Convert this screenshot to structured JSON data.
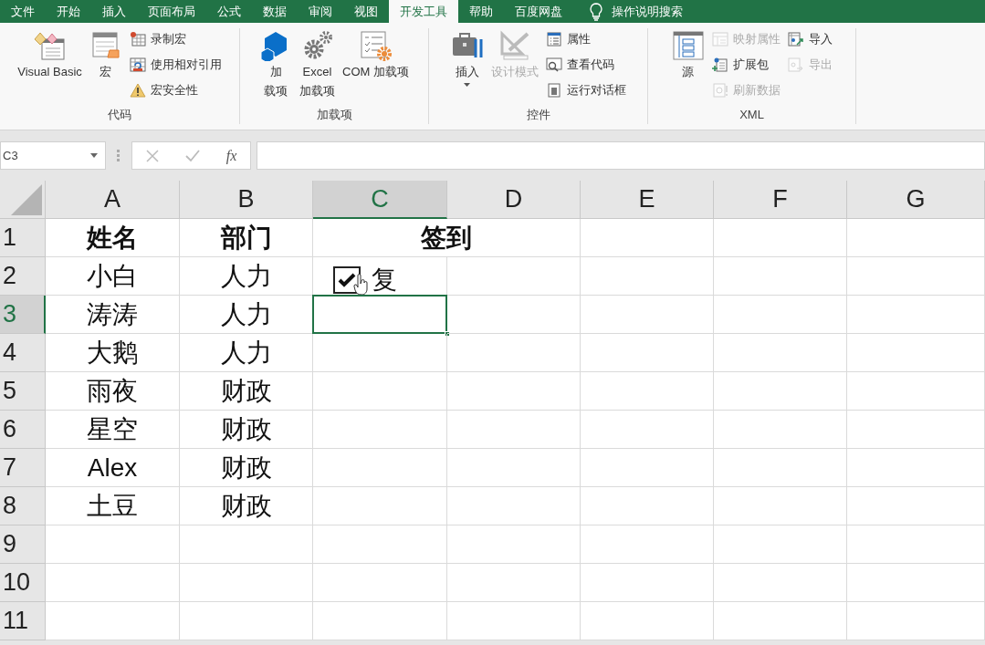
{
  "menu_tabs": [
    {
      "label": "文件",
      "selected": false
    },
    {
      "label": "开始",
      "selected": false
    },
    {
      "label": "插入",
      "selected": false
    },
    {
      "label": "页面布局",
      "selected": false
    },
    {
      "label": "公式",
      "selected": false
    },
    {
      "label": "数据",
      "selected": false
    },
    {
      "label": "审阅",
      "selected": false
    },
    {
      "label": "视图",
      "selected": false
    },
    {
      "label": "开发工具",
      "selected": true
    },
    {
      "label": "帮助",
      "selected": false
    },
    {
      "label": "百度网盘",
      "selected": false
    }
  ],
  "tell_me": {
    "placeholder": "操作说明搜索"
  },
  "ribbon_groups": [
    {
      "title": "代码",
      "columns": [
        [
          {
            "label": "Visual Basic",
            "kind": "large",
            "disabled": false
          }
        ],
        [
          {
            "label": "宏",
            "kind": "large",
            "disabled": false
          }
        ],
        [
          {
            "label": "录制宏",
            "kind": "small",
            "disabled": false
          },
          {
            "label": "使用相对引用",
            "kind": "small",
            "disabled": false
          },
          {
            "label": "宏安全性",
            "kind": "small",
            "disabled": false
          }
        ]
      ]
    },
    {
      "title": "加载项",
      "columns": [
        [
          {
            "lines": [
              "加",
              "载项"
            ],
            "kind": "large",
            "disabled": false
          }
        ],
        [
          {
            "lines": [
              "Excel",
              "加载项"
            ],
            "kind": "large",
            "disabled": false
          }
        ],
        [
          {
            "label": "COM 加载项",
            "kind": "large",
            "disabled": false
          }
        ]
      ]
    },
    {
      "title": "控件",
      "columns": [
        [
          {
            "label": "插入",
            "kind": "dropdown",
            "disabled": false
          }
        ],
        [
          {
            "label": "设计模式",
            "kind": "large",
            "disabled": true
          }
        ],
        [
          {
            "label": "属性",
            "kind": "small",
            "disabled": false
          },
          {
            "label": "查看代码",
            "kind": "small",
            "disabled": false
          },
          {
            "label": "运行对话框",
            "kind": "small",
            "disabled": false
          }
        ]
      ]
    },
    {
      "title": "XML",
      "columns": [
        [
          {
            "label": "源",
            "kind": "large",
            "disabled": false
          }
        ],
        [
          {
            "label": "映射属性",
            "kind": "small",
            "disabled": true
          },
          {
            "label": "扩展包",
            "kind": "small",
            "disabled": false
          },
          {
            "label": "刷新数据",
            "kind": "small",
            "disabled": true
          }
        ],
        [
          {
            "label": "导入",
            "kind": "small",
            "disabled": false
          },
          {
            "label": "导出",
            "kind": "small",
            "disabled": true
          }
        ]
      ]
    }
  ],
  "name_box": "C3",
  "fx_label": "fx",
  "columns": [
    {
      "label": "A",
      "selected": false
    },
    {
      "label": "B",
      "selected": false
    },
    {
      "label": "C",
      "selected": true
    },
    {
      "label": "D",
      "selected": false
    },
    {
      "label": "E",
      "selected": false
    },
    {
      "label": "F",
      "selected": false
    },
    {
      "label": "G",
      "selected": false
    }
  ],
  "rows": [
    {
      "label": "1",
      "selected": false,
      "header": true,
      "cells": [
        "姓名",
        "部门"
      ],
      "merged_title": "签到"
    },
    {
      "label": "2",
      "selected": false,
      "header": false,
      "cells": [
        "小白",
        "人力"
      ],
      "checkbox": {
        "label": "复",
        "checked": true
      }
    },
    {
      "label": "3",
      "selected": true,
      "header": false,
      "cells": [
        "涛涛",
        "人力"
      ]
    },
    {
      "label": "4",
      "selected": false,
      "header": false,
      "cells": [
        "大鹅",
        "人力"
      ]
    },
    {
      "label": "5",
      "selected": false,
      "header": false,
      "cells": [
        "雨夜",
        "财政"
      ]
    },
    {
      "label": "6",
      "selected": false,
      "header": false,
      "cells": [
        "星空",
        "财政"
      ]
    },
    {
      "label": "7",
      "selected": false,
      "header": false,
      "cells": [
        "Alex",
        "财政"
      ]
    },
    {
      "label": "8",
      "selected": false,
      "header": false,
      "cells": [
        "土豆",
        "财政"
      ]
    },
    {
      "label": "9",
      "selected": false,
      "cells": []
    },
    {
      "label": "10",
      "selected": false,
      "cells": []
    },
    {
      "label": "11",
      "selected": false,
      "cells": []
    }
  ]
}
